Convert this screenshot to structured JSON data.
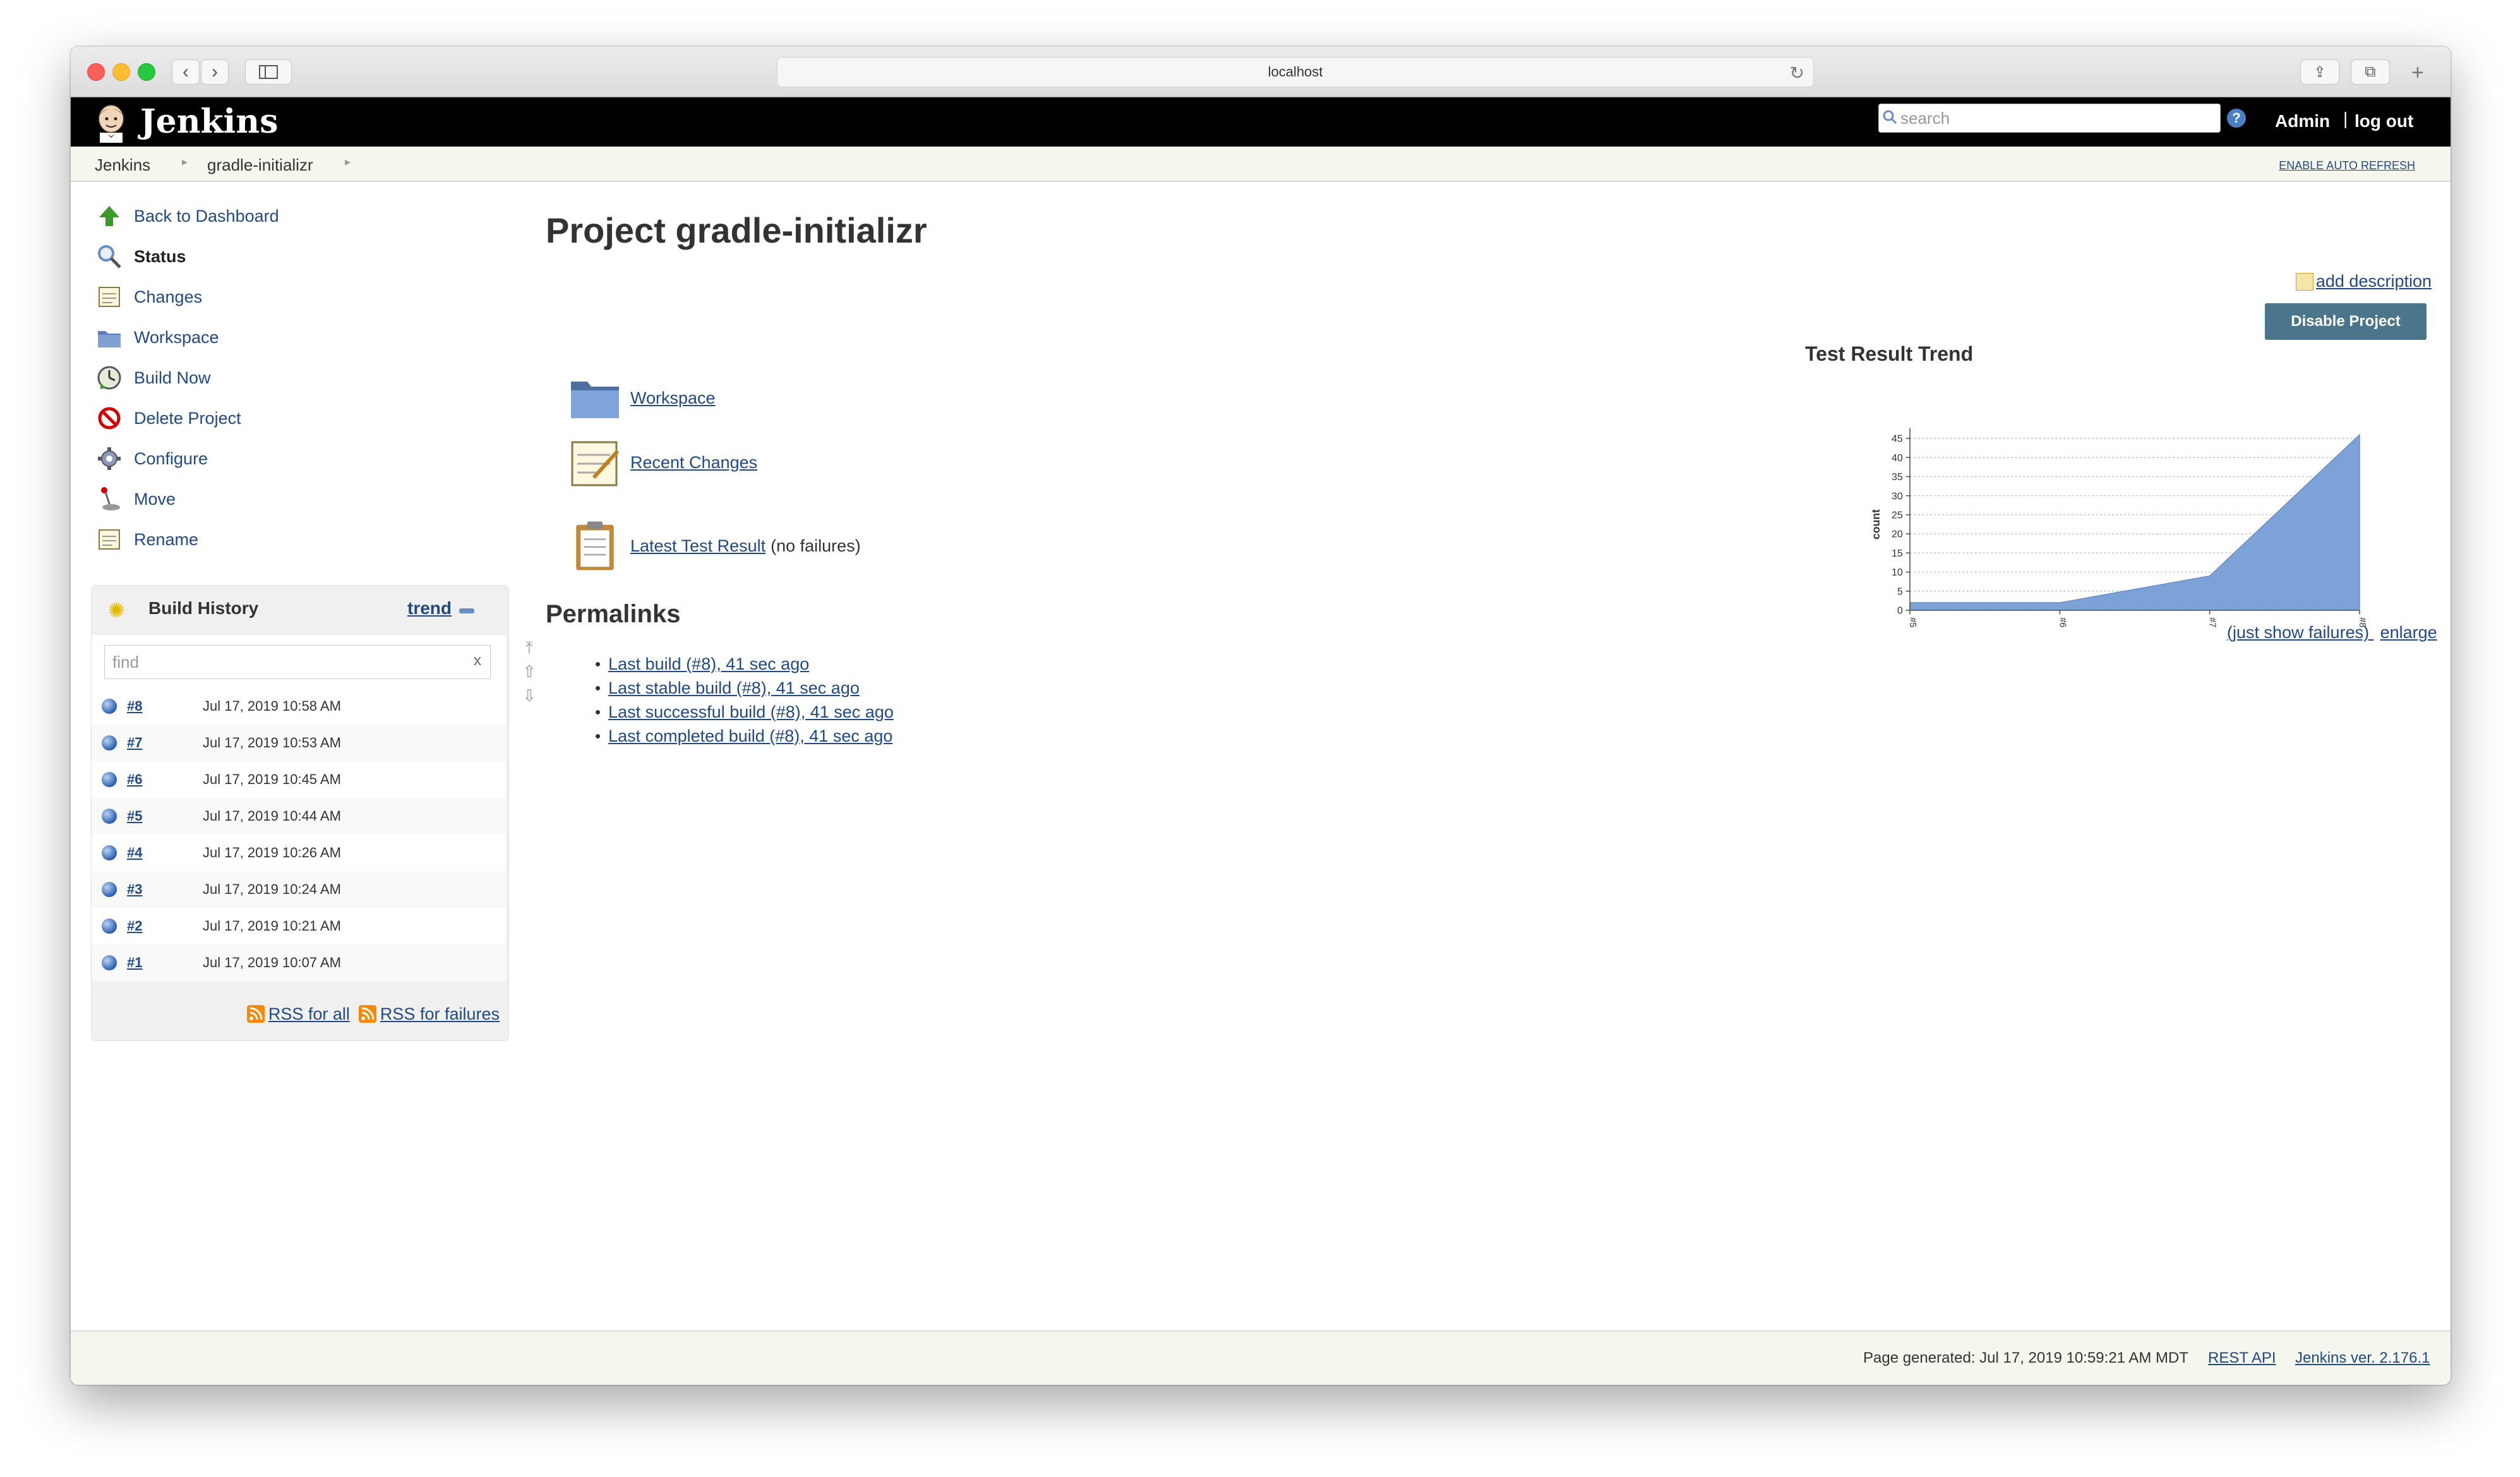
{
  "browser": {
    "url": "localhost"
  },
  "header": {
    "brand": "Jenkins",
    "search_placeholder": "search",
    "help_label": "?",
    "admin": "Admin",
    "logout": "log out"
  },
  "breadcrumb": {
    "items": [
      "Jenkins",
      "gradle-initializr"
    ],
    "auto_refresh": "ENABLE AUTO REFRESH"
  },
  "tasks": [
    {
      "label": "Back to Dashboard",
      "icon": "up-arrow-icon"
    },
    {
      "label": "Status",
      "icon": "magnifier-icon"
    },
    {
      "label": "Changes",
      "icon": "notepad-icon"
    },
    {
      "label": "Workspace",
      "icon": "folder-icon"
    },
    {
      "label": "Build Now",
      "icon": "clock-build-icon"
    },
    {
      "label": "Delete Project",
      "icon": "no-entry-icon"
    },
    {
      "label": "Configure",
      "icon": "gear-icon"
    },
    {
      "label": "Move",
      "icon": "joystick-icon"
    },
    {
      "label": "Rename",
      "icon": "notepad-icon"
    }
  ],
  "build_history": {
    "title": "Build History",
    "trend": "trend",
    "find_placeholder": "find",
    "clear": "x",
    "builds": [
      {
        "num": "#8",
        "date": "Jul 17, 2019 10:58 AM"
      },
      {
        "num": "#7",
        "date": "Jul 17, 2019 10:53 AM"
      },
      {
        "num": "#6",
        "date": "Jul 17, 2019 10:45 AM"
      },
      {
        "num": "#5",
        "date": "Jul 17, 2019 10:44 AM"
      },
      {
        "num": "#4",
        "date": "Jul 17, 2019 10:26 AM"
      },
      {
        "num": "#3",
        "date": "Jul 17, 2019 10:24 AM"
      },
      {
        "num": "#2",
        "date": "Jul 17, 2019 10:21 AM"
      },
      {
        "num": "#1",
        "date": "Jul 17, 2019 10:07 AM"
      }
    ],
    "rss_all": "RSS for all",
    "rss_failures": "RSS for failures"
  },
  "main": {
    "title": "Project gradle-initializr",
    "add_description": "add description",
    "disable_project": "Disable Project",
    "links": {
      "workspace": "Workspace",
      "recent_changes": "Recent Changes",
      "latest_test_result": "Latest Test Result",
      "no_failures": "(no failures)"
    },
    "permalinks_title": "Permalinks",
    "permalinks": [
      "Last build (#8), 41 sec ago",
      "Last stable build (#8), 41 sec ago",
      "Last successful build (#8), 41 sec ago",
      "Last completed build (#8), 41 sec ago"
    ],
    "chart_links": {
      "just_failures": "(just show failures)",
      "enlarge": "enlarge"
    }
  },
  "chart_data": {
    "type": "area",
    "title": "Test Result Trend",
    "ylabel": "count",
    "xlabel": "",
    "x": [
      "#5",
      "#6",
      "#7",
      "#8"
    ],
    "series": [
      {
        "values": [
          2,
          2,
          9,
          46
        ],
        "color": "#7da2d8"
      }
    ],
    "ylim": [
      0,
      45
    ],
    "yticks": [
      0,
      5,
      10,
      15,
      20,
      25,
      30,
      35,
      40,
      45
    ],
    "grid": true
  },
  "footer": {
    "generated": "Page generated: Jul 17, 2019 10:59:21 AM MDT",
    "rest_api": "REST API",
    "version": "Jenkins ver. 2.176.1"
  },
  "colors": {
    "link": "#204a87",
    "header_bg": "#000000",
    "button_bg": "#4b758b",
    "breadcrumb_bg": "#f5f7ef"
  }
}
